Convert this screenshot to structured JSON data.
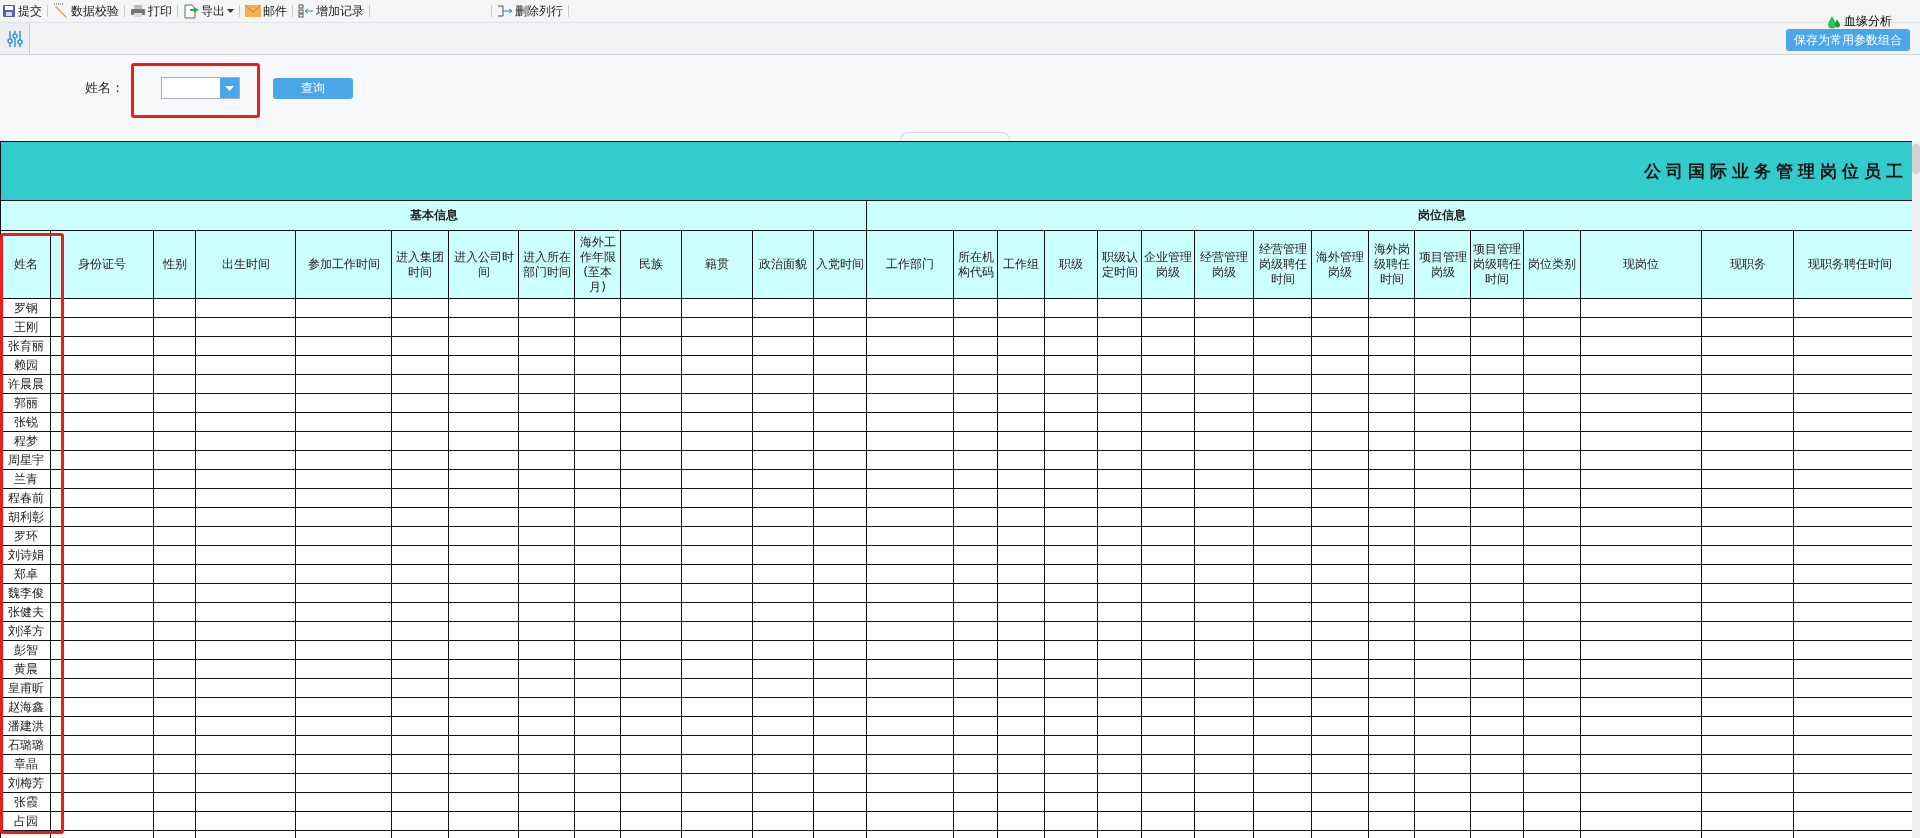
{
  "toolbar": {
    "groups": [
      [
        {
          "label": "提交",
          "has_menu": false
        },
        {
          "label": "数据校验",
          "has_menu": false
        },
        {
          "label": "打印",
          "has_menu": false
        },
        {
          "label": "导出",
          "has_menu": true
        },
        {
          "label": "邮件",
          "has_menu": false
        },
        {
          "label": "增加记录",
          "has_menu": false
        }
      ],
      [
        {
          "label": "删除列行",
          "has_menu": false
        }
      ]
    ],
    "lineage": "血缘分析",
    "save_params": "保存为常用参数组合"
  },
  "filter": {
    "label": "姓名：",
    "button": "查询"
  },
  "table": {
    "title": "公司国际业务管理岗位员工",
    "sections": [
      {
        "title": "基本信息",
        "columns": [
          "姓名",
          "身份证号",
          "性别",
          "出生时间",
          "参加工作时间",
          "进入集团时间",
          "进入公司时间",
          "进入所在部门时间",
          "海外工作年限(至本月)",
          "民族",
          "籍贯",
          "政治面貌",
          "入党时间"
        ]
      },
      {
        "title": "岗位信息",
        "columns": [
          "工作部门",
          "所在机构代码",
          "工作组",
          "职级",
          "职级认定时间",
          "企业管理岗级",
          "经营管理岗级",
          "经营管理岗级聘任时间",
          "海外管理岗级",
          "海外岗级聘任时间",
          "项目管理岗级",
          "项目管理岗级聘任时间",
          "岗位类别",
          "现岗位",
          "现职务",
          "现职务聘任时间"
        ]
      }
    ],
    "rows": [
      "罗钢",
      "王刚",
      "张育丽",
      "赖园",
      "许晨晨",
      "郭丽",
      "张锐",
      "程梦",
      "周星宇",
      "兰青",
      "程春前",
      "胡利彰",
      "罗环",
      "刘诗娟",
      "郑卓",
      "魏李俊",
      "张健夫",
      "刘泽方",
      "彭智",
      "黄晨",
      "皇甫昕",
      "赵海鑫",
      "潘建洪",
      "石璐璐",
      "章晶",
      "刘梅芳",
      "张霞",
      "占园"
    ]
  }
}
